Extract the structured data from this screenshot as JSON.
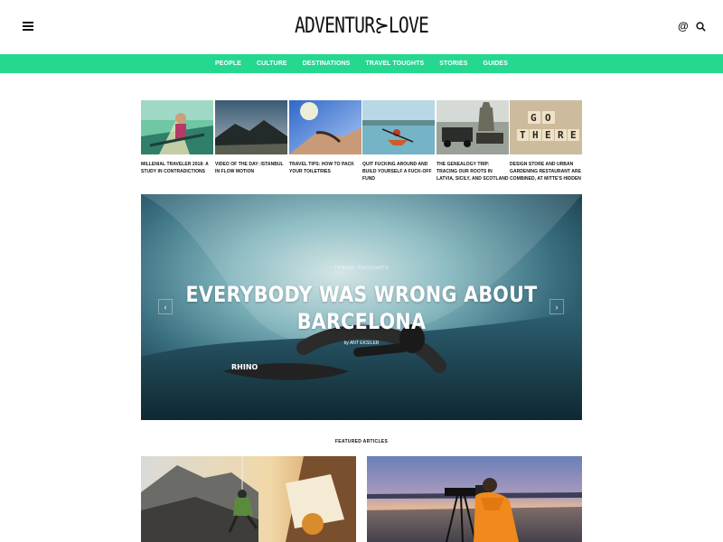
{
  "header": {
    "logo": "ADVENTUR⊱LOVE",
    "menu_icon": "hamburger-menu-icon",
    "at_icon": "@",
    "search_icon": "search-icon"
  },
  "nav": {
    "items": [
      "PEOPLE",
      "CULTURE",
      "DESTINATIONS",
      "TRAVEL TOUGHTS",
      "STORIES",
      "GUIDES"
    ]
  },
  "thumbs": [
    {
      "caption": "MILLENIAL TRAVELER 2018: A STUDY IN CONTRADICTIONS"
    },
    {
      "caption": "VIDEO OF THE DAY: ISTANBUL IN FLOW MOTION"
    },
    {
      "caption": "TRAVEL TIPS: HOW TO PACK YOUR TOILETRIES"
    },
    {
      "caption": "QUIT FUCKING AROUND AND BUILD YOURSELF A FUCK-OFF FUND"
    },
    {
      "caption": "THE GENEALOGY TRIP: TRACING OUR ROOTS IN LATVIA, SICILY, AND SCOTLAND"
    },
    {
      "caption": "DESIGN STORE AND URBAN GARDENING RESTAURANT ARE COMBINED, AT MITTE'S HIDDEN"
    }
  ],
  "hero": {
    "category": "TRAVEL THOUGHTS",
    "title_line1": "EVERYBODY WAS WRONG ABOUT",
    "title_line2": "BARCELONA",
    "author": "by ANT EKSILER",
    "prev": "‹",
    "next": "›",
    "board_text": "RHINO"
  },
  "featured": {
    "label": "FEATURED ARTICLES"
  },
  "colors": {
    "accent": "#24d88f"
  }
}
